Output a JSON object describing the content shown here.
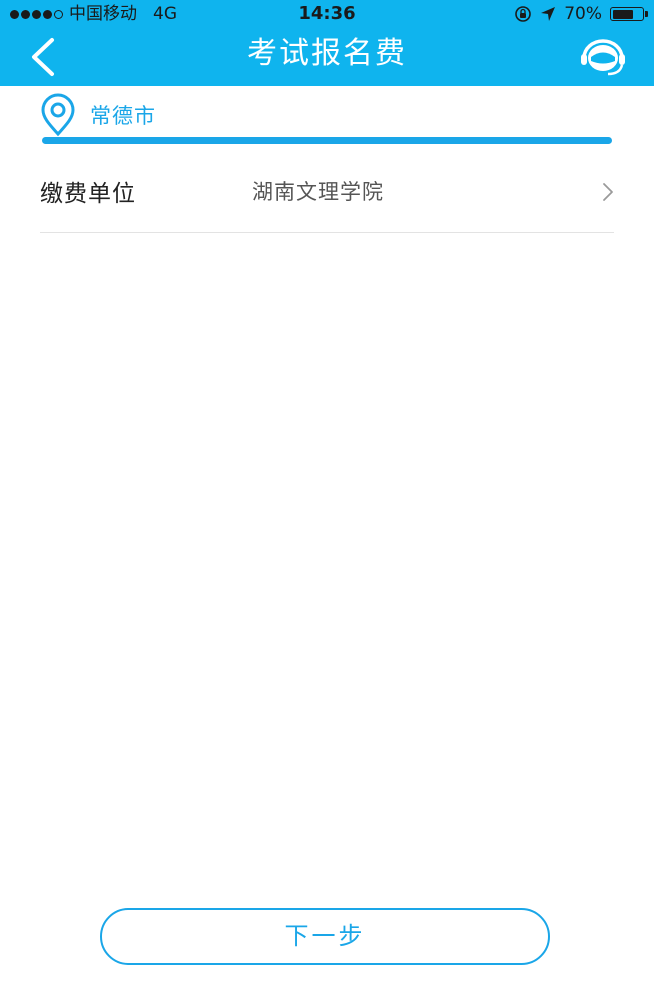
{
  "status_bar": {
    "carrier": "中国移动",
    "network": "4G",
    "time": "14:36",
    "battery_percent": "70%",
    "battery_level": 0.7
  },
  "header": {
    "title": "考试报名费",
    "icons": [
      "back-icon",
      "customer-service-icon"
    ]
  },
  "location": {
    "city": "常德市",
    "icon": "location-pin-icon"
  },
  "payment_unit": {
    "label": "缴费单位",
    "value": "湖南文理学院"
  },
  "footer": {
    "next_label": "下一步"
  },
  "colors": {
    "header_bg": "#0fb4ee",
    "accent": "#1aa6e8",
    "divider": "#e3e3e3"
  }
}
